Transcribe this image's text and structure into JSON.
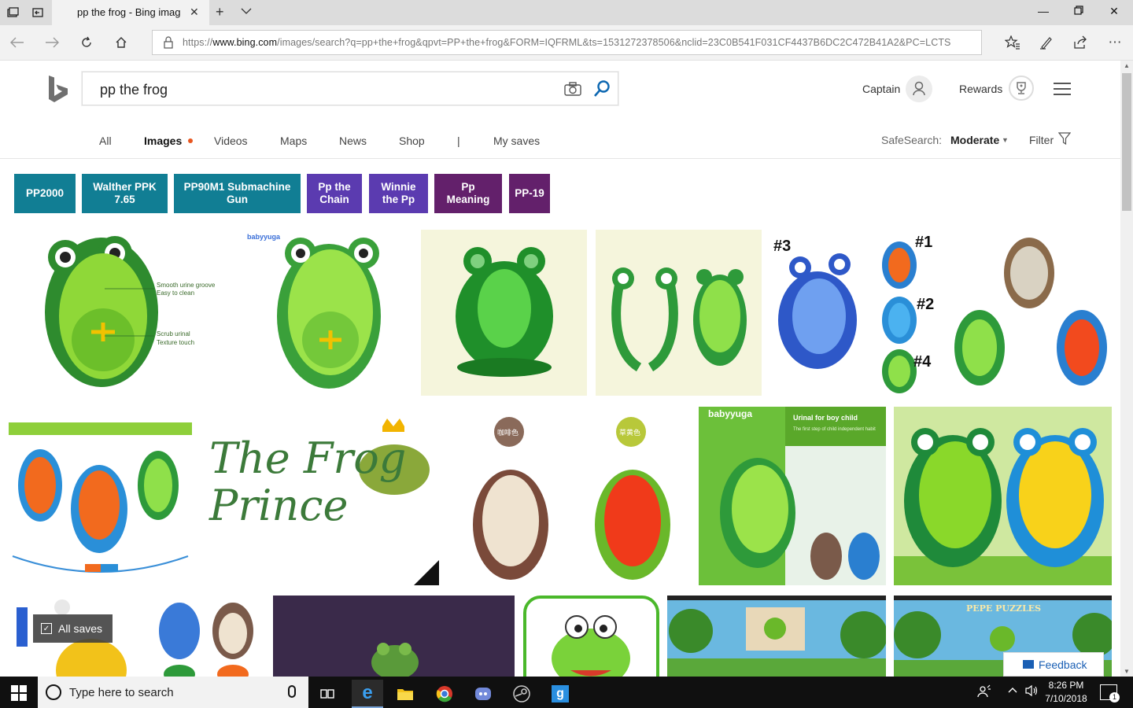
{
  "browser": {
    "tab_title": "pp the frog - Bing imag",
    "url_prefix": "https://",
    "url_host": "www.bing.com",
    "url_rest": "/images/search?q=pp+the+frog&qpvt=PP+the+frog&FORM=IQFRML&ts=1531272378506&nclid=23C0B541F031CF4437B6DC2C472B41A2&PC=LCTS"
  },
  "search": {
    "query": "pp the frog"
  },
  "account": {
    "name": "Captain",
    "rewards_label": "Rewards"
  },
  "scopes": [
    "All",
    "Images",
    "Videos",
    "Maps",
    "News",
    "Shop",
    "|",
    "My saves"
  ],
  "safesearch": {
    "label": "SafeSearch:",
    "value": "Moderate",
    "filter_label": "Filter"
  },
  "chips": [
    {
      "label": "PP2000"
    },
    {
      "label": "Walther PPK 7.65"
    },
    {
      "label": "PP90M1 Submachine Gun"
    },
    {
      "label": "Pp the Chain"
    },
    {
      "label": "Winnie the Pp"
    },
    {
      "label": "Pp Meaning"
    },
    {
      "label": "PP-19"
    }
  ],
  "tiles": {
    "t1_caption_a": "Smooth urine groove",
    "t1_caption_b": "Easy to clean",
    "t1_caption_c": "Scrub urinal",
    "t1_caption_d": "Texture touch",
    "t2_brand": "babyyuga",
    "t5_n1": "#1",
    "t5_n2": "#2",
    "t5_n3": "#3",
    "t5_n4": "#4",
    "t8_title": "The Frog Prince",
    "t9_label_a": "咖啡色",
    "t9_label_b": "草黄色",
    "t10_brand": "babyyuga",
    "t10_title": "Urinal for boy child",
    "t10_sub": "The first step of child independent habit",
    "t16_title": "PEPE PUZZLES"
  },
  "overlays": {
    "all_saves": "All saves",
    "feedback": "Feedback"
  },
  "taskbar": {
    "search_placeholder": "Type here to search",
    "time": "8:26 PM",
    "date": "7/10/2018",
    "notif_count": "1"
  },
  "colors": {
    "chip_teal": "#117e94",
    "chip_purple": "#5b3bb0",
    "chip_dark_purple": "#63206b",
    "accent_dot": "#e8561f",
    "bing_blue": "#1a5fb4"
  }
}
